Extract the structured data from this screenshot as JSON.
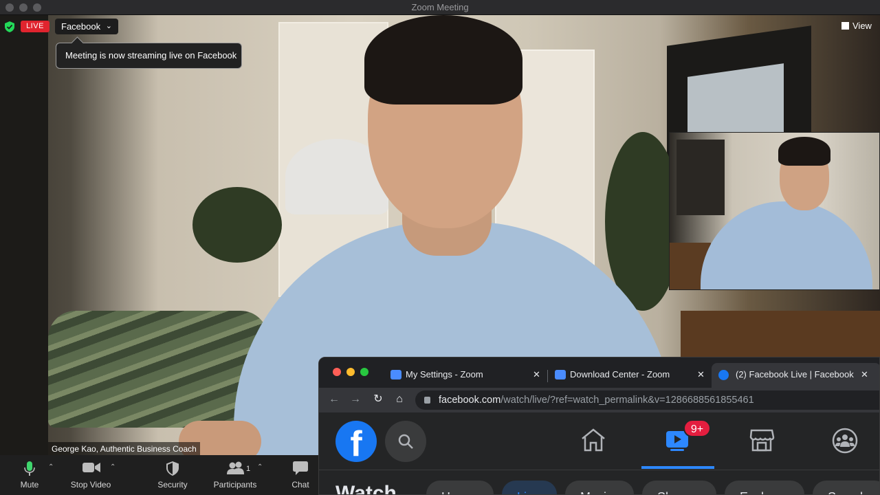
{
  "window": {
    "title": "Zoom Meeting"
  },
  "live": {
    "badge": "LIVE",
    "platform": "Facebook",
    "tooltip": "Meeting is now streaming live on Facebook"
  },
  "view_button": {
    "label": "View"
  },
  "participant": {
    "name": "George Kao, Authentic Business Coach"
  },
  "toolbar": {
    "mute": "Mute",
    "stop_video": "Stop Video",
    "security": "Security",
    "participants": "Participants",
    "participants_count": "1",
    "chat": "Chat"
  },
  "browser": {
    "tabs": [
      {
        "label": "My Settings - Zoom"
      },
      {
        "label": "Download Center - Zoom"
      },
      {
        "label": "(2) Facebook Live | Facebook"
      }
    ],
    "url_host": "facebook.com",
    "url_path": "/watch/live/?ref=watch_permalink&v=1286688561855461"
  },
  "facebook": {
    "logo": "f",
    "watch_badge": "9+",
    "watch_title": "Watch",
    "pills": [
      "Home",
      "Live",
      "Music",
      "Shows",
      "Explore",
      "Saved"
    ]
  },
  "colors": {
    "live_red": "#e0242e",
    "facebook_blue": "#1877f2",
    "notification_red": "#e41e3f",
    "active_tab_blue": "#2d88ff"
  },
  "icons": [
    "shield-icon",
    "chevron-down-icon",
    "grid-view-icon",
    "microphone-icon",
    "camera-icon",
    "security-shield-icon",
    "participants-icon",
    "chat-icon",
    "zoom-icon",
    "facebook-icon",
    "back-icon",
    "forward-icon",
    "reload-icon",
    "home-icon",
    "lock-icon",
    "search-icon",
    "watch-icon",
    "marketplace-icon",
    "groups-icon"
  ]
}
